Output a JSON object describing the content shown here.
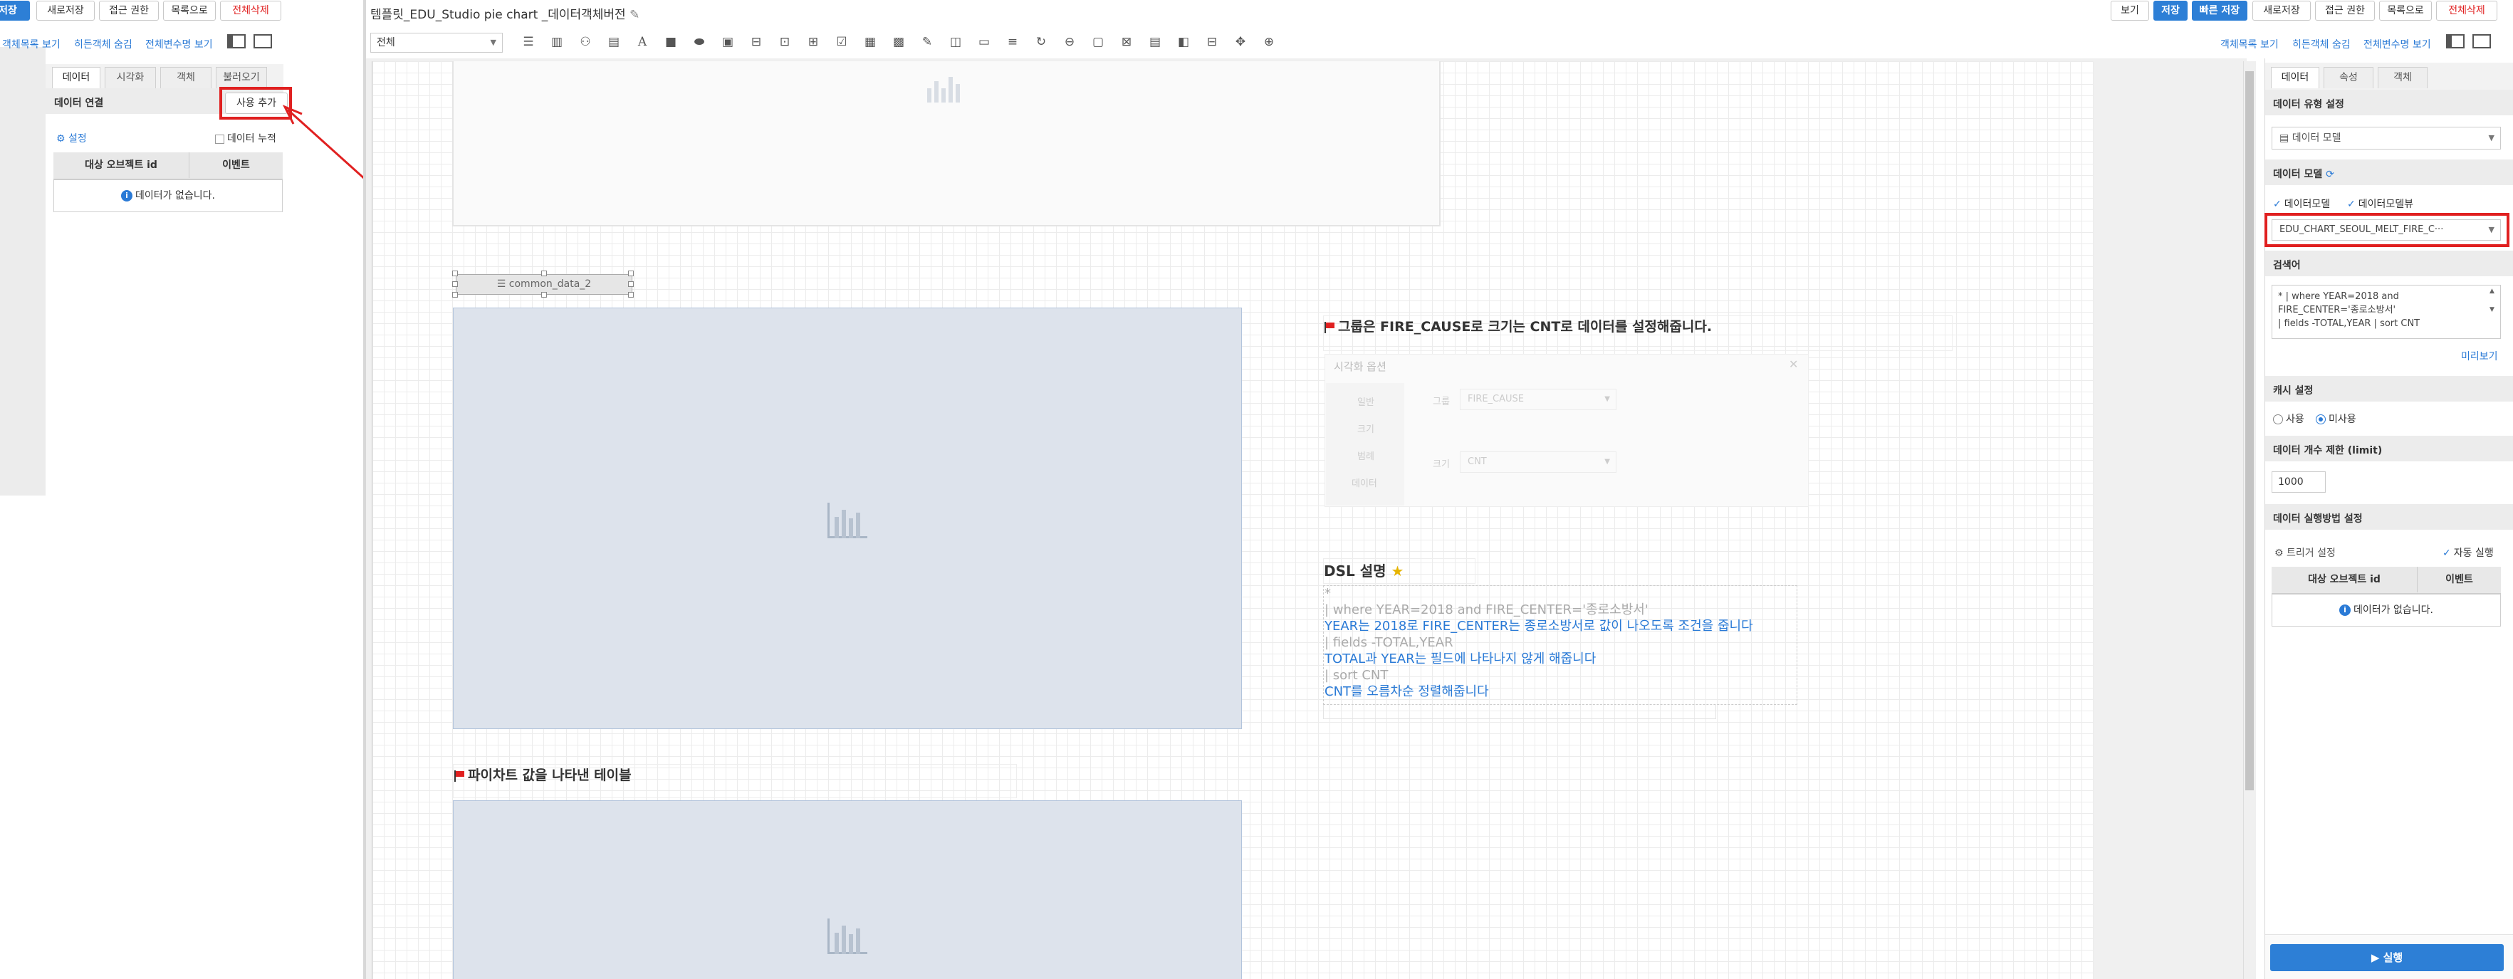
{
  "left_panel": {
    "top_buttons": [
      "저장",
      "새로저장",
      "접근 권한",
      "목록으로",
      "전체삭제"
    ],
    "links": [
      "객체목록 보기",
      "히든객체 숨김",
      "전체변수명 보기"
    ],
    "tabs": [
      "데이터",
      "시각화",
      "객체",
      "불러오기"
    ],
    "section_title": "데이터 연결",
    "add_button": "사용 추가",
    "settings_label": "설정",
    "accumulate_label": "데이터 누적",
    "table_headers": [
      "대상 오브젝트 id",
      "이벤트"
    ],
    "empty_message": "데이터가 없습니다."
  },
  "center": {
    "title": "템플릿_EDU_Studio pie chart _데이터객체버전",
    "filter_select": "전체",
    "canvas": {
      "data_object_label": "common_data_2",
      "group_note": "그룹은 FIRE_CAUSE로 크기는 CNT로 데이터를 설정해줍니다.",
      "faded_panel": {
        "title": "시각화 옵션",
        "side_labels": [
          "일반",
          "크기",
          "범례",
          "데이터"
        ],
        "group_label": "그룹",
        "group_value": "FIRE_CAUSE",
        "size_label": "크기",
        "size_value": "CNT"
      },
      "dsl_title": "DSL 설명",
      "dsl_lines": [
        {
          "text": "*",
          "style": "gray"
        },
        {
          "text": "| where YEAR=2018 and FIRE_CENTER='종로소방서'",
          "style": "gray"
        },
        {
          "text": "YEAR는 2018로 FIRE_CENTER는 종로소방서로 값이 나오도록 조건을 줍니다",
          "style": "blue"
        },
        {
          "text": "| fields -TOTAL,YEAR",
          "style": "gray"
        },
        {
          "text": "TOTAL과 YEAR는 필드에 나타나지 않게 해줍니다",
          "style": "blue"
        },
        {
          "text": "| sort CNT",
          "style": "gray"
        },
        {
          "text": "CNT를 오름차순 정렬해줍니다",
          "style": "blue"
        }
      ],
      "table_note": "파이차트 값을 나타낸 테이블"
    }
  },
  "right_header": {
    "buttons": [
      "보기",
      "저장",
      "빠른 저장",
      "새로저장",
      "접근 권한",
      "목록으로",
      "전체삭제"
    ],
    "links": [
      "객체목록 보기",
      "히든객체 숨김",
      "전체변수명 보기"
    ]
  },
  "right_panel": {
    "tabs": [
      "데이터",
      "속성",
      "객체"
    ],
    "data_type_title": "데이터 유형 설정",
    "data_type_value": "데이터 모델",
    "data_model_title": "데이터 모델",
    "data_model_checks": [
      "데이터모델",
      "데이터모델뷰"
    ],
    "data_model_value": "EDU_CHART_SEOUL_MELT_FIRE_C···",
    "search_title": "검색어",
    "search_text": "* | where YEAR=2018 and\nFIRE_CENTER='종로소방서'\n| fields -TOTAL,YEAR | sort CNT",
    "preview_link": "미리보기",
    "cache_title": "캐시 설정",
    "cache_options": [
      "사용",
      "미사용"
    ],
    "cache_selected": "미사용",
    "limit_title": "데이터 개수 제한 (limit)",
    "limit_value": "1000",
    "exec_title": "데이터 실행방법 설정",
    "trigger_label": "트리거 설정",
    "auto_run_label": "자동 실행",
    "table_headers": [
      "대상 오브젝트 id",
      "이벤트"
    ],
    "empty_message": "데이터가 없습니다.",
    "run_button": "▶ 실행"
  },
  "colors": {
    "accent": "#2d7fd6",
    "danger": "#e02020",
    "highlight_box": "#e02020",
    "placeholder": "#dde3ec"
  }
}
